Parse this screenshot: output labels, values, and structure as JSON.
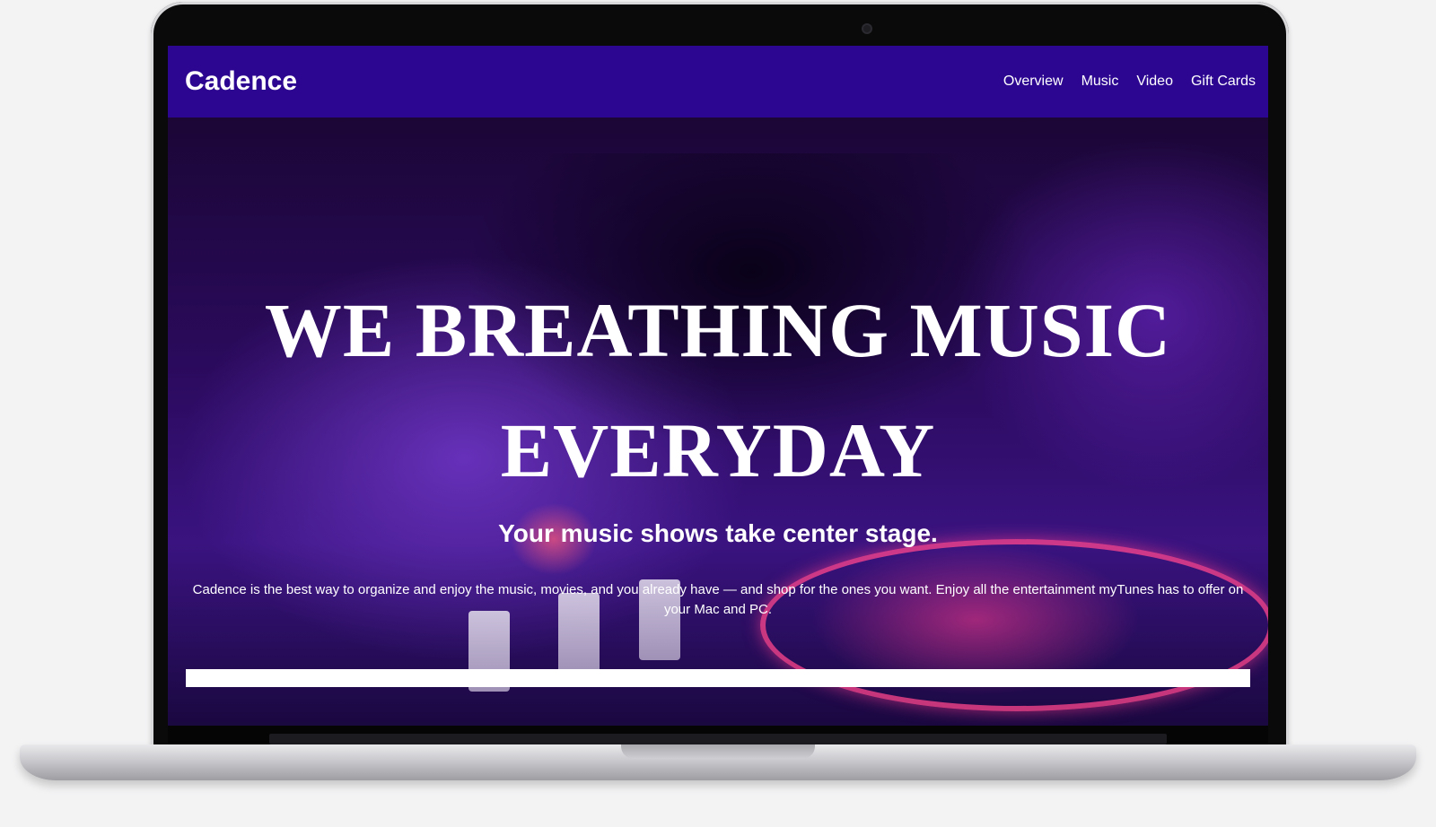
{
  "site": {
    "brand": "Cadence",
    "nav": [
      {
        "label": "Overview"
      },
      {
        "label": "Music"
      },
      {
        "label": "Video"
      },
      {
        "label": "Gift Cards"
      }
    ]
  },
  "hero": {
    "headline": "WE BREATHING MUSIC EVERYDAY",
    "subheadline": "Your music shows take center stage.",
    "description": "Cadence is the best way to organize and enjoy the music, movies, and you already have — and shop for the ones you want. Enjoy all the entertainment myTunes has to offer on your Mac and PC."
  },
  "colors": {
    "navbar": "#2c0691",
    "hero_tint": "#3a1380",
    "text": "#ffffff"
  }
}
